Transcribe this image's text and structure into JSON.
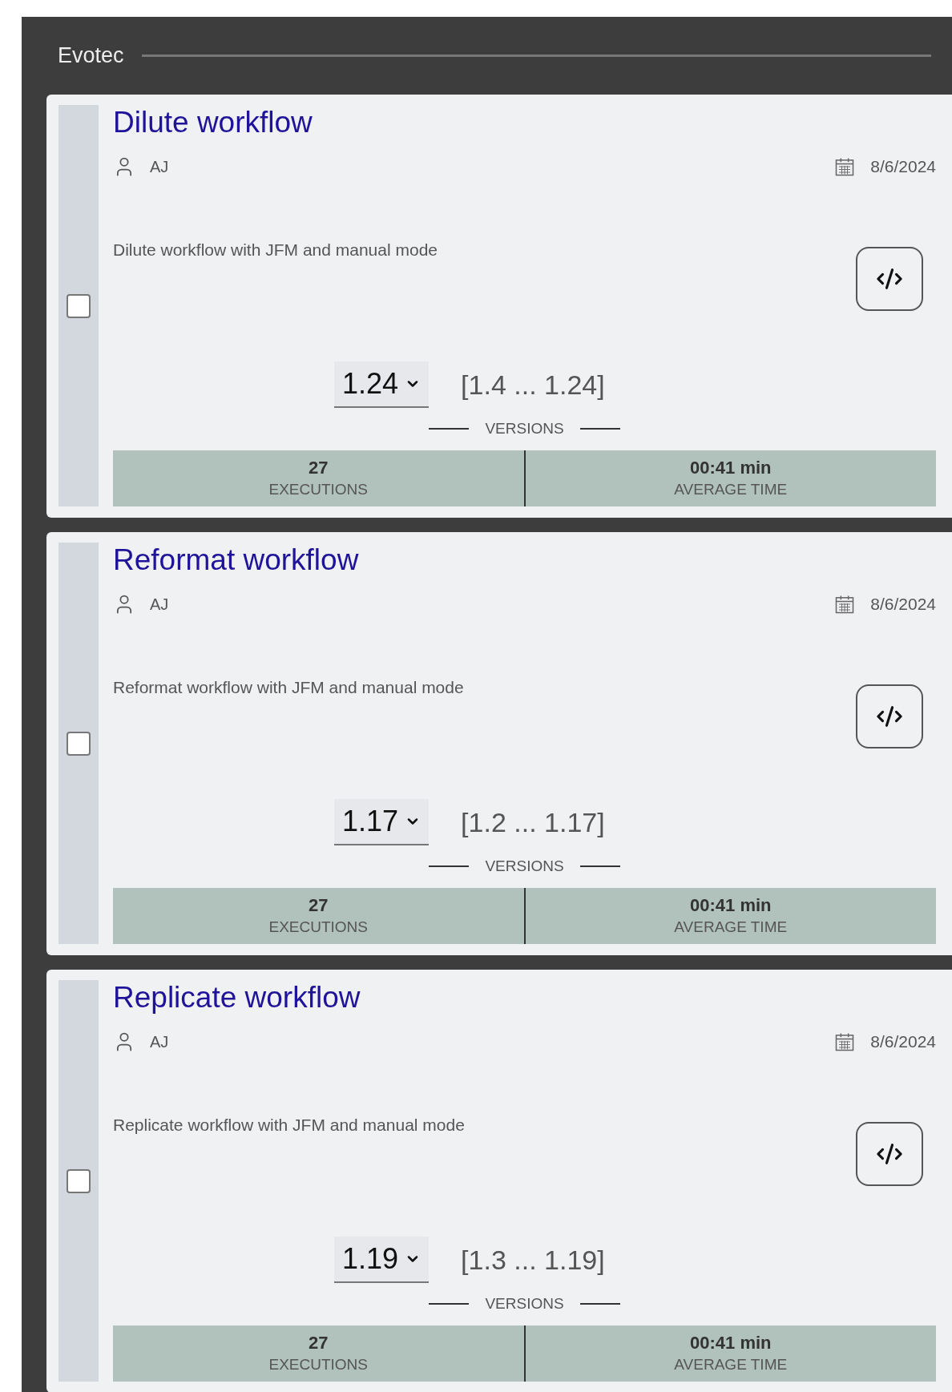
{
  "group": {
    "title": "Evotec"
  },
  "workflows": [
    {
      "title": "Dilute workflow",
      "author": "AJ",
      "date": "8/6/2024",
      "description": "Dilute workflow with JFM and manual mode",
      "checked": false,
      "version": "1.24",
      "version_range": "[1.4 ... 1.24]",
      "versions_label": "VERSIONS",
      "stats": [
        {
          "value": "27",
          "label": "EXECUTIONS"
        },
        {
          "value": "00:41 min",
          "label": "AVERAGE TIME"
        }
      ]
    },
    {
      "title": "Reformat workflow",
      "author": "AJ",
      "date": "8/6/2024",
      "description": "Reformat workflow with JFM and manual mode",
      "checked": false,
      "version": "1.17",
      "version_range": "[1.2 ... 1.17]",
      "versions_label": "VERSIONS",
      "stats": [
        {
          "value": "27",
          "label": "EXECUTIONS"
        },
        {
          "value": "00:41 min",
          "label": "AVERAGE TIME"
        }
      ]
    },
    {
      "title": "Replicate workflow",
      "author": "AJ",
      "date": "8/6/2024",
      "description": "Replicate workflow with JFM and manual mode",
      "checked": false,
      "version": "1.19",
      "version_range": "[1.3 ... 1.19]",
      "versions_label": "VERSIONS",
      "stats": [
        {
          "value": "27",
          "label": "EXECUTIONS"
        },
        {
          "value": "00:41 min",
          "label": "AVERAGE TIME"
        }
      ]
    }
  ]
}
